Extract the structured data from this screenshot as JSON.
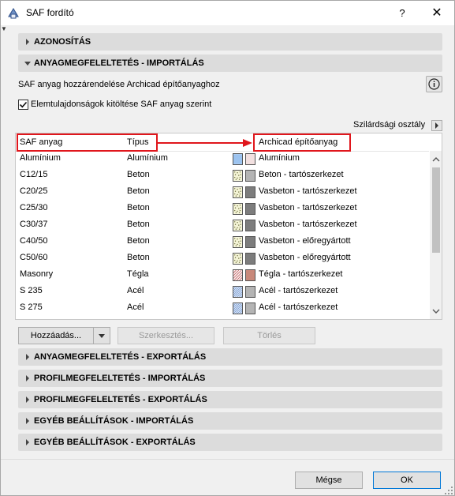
{
  "window": {
    "title": "SAF fordító",
    "help_label": "?",
    "close_label": "✕"
  },
  "sections": {
    "identification": "AZONOSÍTÁS",
    "material_import": "ANYAGMEGFELELTETÉS - IMPORTÁLÁS",
    "material_export": "ANYAGMEGFELELTETÉS - EXPORTÁLÁS",
    "profile_import": "PROFILMEGFELELTETÉS - IMPORTÁLÁS",
    "profile_export": "PROFILMEGFELELTETÉS - EXPORTÁLÁS",
    "other_import": "EGYÉB BEÁLLÍTÁSOK - IMPORTÁLÁS",
    "other_export": "EGYÉB BEÁLLÍTÁSOK - EXPORTÁLÁS"
  },
  "material_import": {
    "subtitle": "SAF anyag hozzárendelése Archicad építőanyaghoz",
    "checkbox_label": "Elemtulajdonságok kitöltése SAF anyag szerint",
    "checkbox_checked": true,
    "strength_class_label": "Szilárdsági osztály",
    "columns": {
      "saf_material": "SAF anyag",
      "type": "Típus",
      "archicad_material": "Archicad építőanyag"
    },
    "rows": [
      {
        "saf": "Alumínium",
        "type": "Alumínium",
        "archicad": "Alumínium",
        "fill": "hatch-blue",
        "color": "#f2e0e0"
      },
      {
        "saf": "C12/15",
        "type": "Beton",
        "archicad": "Beton - tartószerkezet",
        "fill": "dots",
        "color": "#b4b4b4"
      },
      {
        "saf": "C20/25",
        "type": "Beton",
        "archicad": "Vasbeton - tartószerkezet",
        "fill": "dots",
        "color": "#7d7d7d"
      },
      {
        "saf": "C25/30",
        "type": "Beton",
        "archicad": "Vasbeton - tartószerkezet",
        "fill": "dots",
        "color": "#7d7d7d"
      },
      {
        "saf": "C30/37",
        "type": "Beton",
        "archicad": "Vasbeton - tartószerkezet",
        "fill": "dots",
        "color": "#7d7d7d"
      },
      {
        "saf": "C40/50",
        "type": "Beton",
        "archicad": "Vasbeton - előregyártott",
        "fill": "dots",
        "color": "#7d7d7d"
      },
      {
        "saf": "C50/60",
        "type": "Beton",
        "archicad": "Vasbeton - előregyártott",
        "fill": "dots",
        "color": "#7d7d7d"
      },
      {
        "saf": "Masonry",
        "type": "Tégla",
        "archicad": "Tégla - tartószerkezet",
        "fill": "hatch-red",
        "color": "#c8887a"
      },
      {
        "saf": "S 235",
        "type": "Acél",
        "archicad": "Acél - tartószerkezet",
        "fill": "hatch-blue",
        "color": "#b4b4b4"
      },
      {
        "saf": "S 275",
        "type": "Acél",
        "archicad": "Acél - tartószerkezet",
        "fill": "hatch-blue",
        "color": "#b4b4b4"
      }
    ],
    "buttons": {
      "add": "Hozzáadás...",
      "edit": "Szerkesztés...",
      "delete": "Törlés"
    }
  },
  "footer": {
    "cancel": "Mégse",
    "ok": "OK"
  },
  "colors": {
    "highlight": "#e0161c",
    "section_bg": "#dcdcdc",
    "ok_border": "#0078d7"
  }
}
